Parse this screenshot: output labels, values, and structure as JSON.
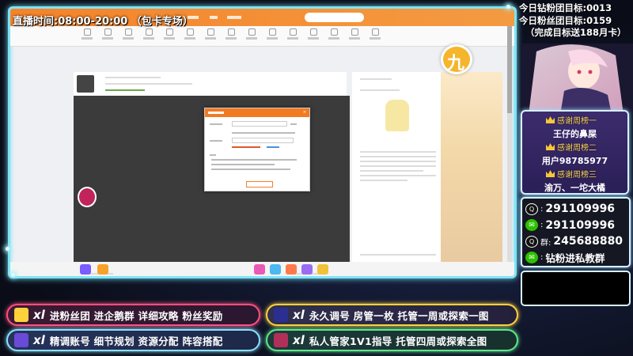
{
  "stream_title": "直播时间:08:00-20:00 （包卡专场）",
  "goals": {
    "diamond_fans": "今日钻粉团目标:0013",
    "fans": "今日粉丝团目标:0159",
    "reward": "（完成目标送188月卡）"
  },
  "thanks_board": {
    "rank1_title": "感谢周榜一",
    "rank1_name": "王仔的鼻屎",
    "rank2_title": "感谢周榜二",
    "rank2_name": "用户98785977",
    "rank3_title": "感谢周榜三",
    "rank3_name": "渝万、一坨大橘"
  },
  "contacts": {
    "qq1": "291109996",
    "wechat": "291109996",
    "group_label": "群:",
    "group": "245688880",
    "diamond_text": "钻粉进私教群"
  },
  "banners": {
    "b1_xl": "xl",
    "b1_text": "进粉丝团 进企鹅群 详细攻略 粉丝奖励",
    "b2_xl": "xl",
    "b2_text": "永久调号 房管一枚 托管一周或探索一图",
    "b3_xl": "xl",
    "b3_text": "精调账号 细节规划 资源分配 阵容搭配",
    "b4_xl": "xl",
    "b4_text": "私人管家1V1指导 托管四周或探索全图"
  },
  "colors": {
    "stage_border": "#7fe3f6",
    "banner1": "#ff4f7e",
    "banner2": "#ffd23c",
    "banner3": "#8ae0ff",
    "banner4": "#5ee88a",
    "browser_accent": "#f5832a"
  },
  "icons": {
    "crown": "crown-icon",
    "qq": "qq-icon",
    "wechat": "wechat-icon",
    "badge": "xl-badge-icon"
  }
}
